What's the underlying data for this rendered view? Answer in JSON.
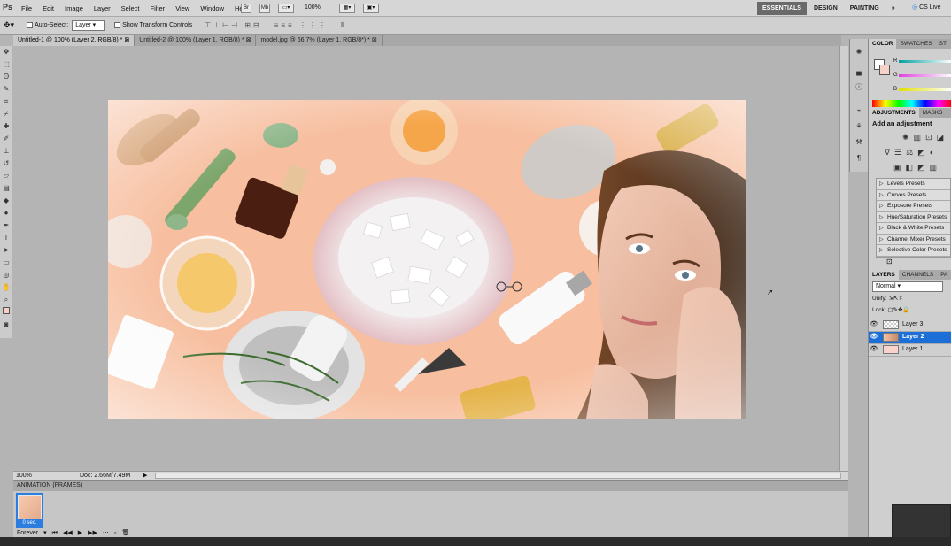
{
  "app": {
    "logo": "Ps"
  },
  "menu": [
    "File",
    "Edit",
    "Image",
    "Layer",
    "Select",
    "Filter",
    "View",
    "Window",
    "Help"
  ],
  "menubar_extras": {
    "br": "Br",
    "mb": "Mb",
    "zoom": "100%"
  },
  "workspaces": [
    "ESSENTIALS",
    "DESIGN",
    "PAINTING"
  ],
  "workspace_more": "»",
  "cslive": "CS Live",
  "options": {
    "auto_select": "Auto-Select:",
    "auto_select_value": "Layer",
    "show_transform": "Show Transform Controls"
  },
  "tabs": [
    "Untitled-1 @ 100% (Layer 2, RGB/8) *",
    "Untitled-2 @ 100% (Layer 1, RGB/8) *",
    "model.jpg @ 66.7% (Layer 1, RGB/8*) *"
  ],
  "status": {
    "zoom": "100%",
    "doc": "Doc: 2.66M/7.49M"
  },
  "animation": {
    "title": "ANIMATION (FRAMES)",
    "frame_time": "0 sec.",
    "loop": "Forever"
  },
  "color_panel": {
    "tabs": [
      "COLOR",
      "SWATCHES",
      "ST"
    ],
    "r": "R",
    "g": "G",
    "b": "B"
  },
  "adjustments": {
    "tabs": [
      "ADJUSTMENTS",
      "MASKS"
    ],
    "heading": "Add an adjustment",
    "presets": [
      "Levels Presets",
      "Curves Presets",
      "Exposure Presets",
      "Hue/Saturation Presets",
      "Black & White Presets",
      "Channel Mixer Presets",
      "Selective Color Presets"
    ]
  },
  "layers_panel": {
    "tabs": [
      "LAYERS",
      "CHANNELS",
      "PA"
    ],
    "blend": "Normal",
    "unify": "Unify:",
    "lock": "Lock:",
    "layers": [
      "Layer 3",
      "Layer 2",
      "Layer 1"
    ]
  },
  "colors": {
    "accent": "#1c6fd6",
    "chrome": "#d0d0d0",
    "canvas_bg": "#f8c3a4"
  }
}
